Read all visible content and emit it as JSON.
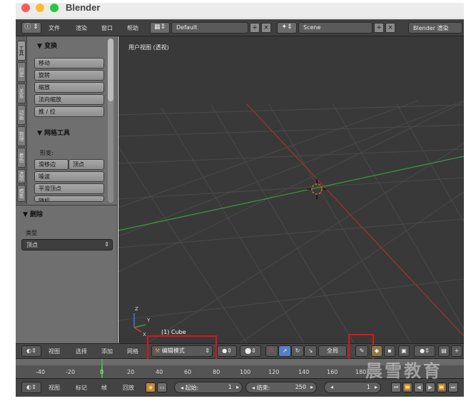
{
  "window": {
    "title": "Blender"
  },
  "info_header": {
    "menus": [
      "文件",
      "渲染",
      "窗口",
      "帮助"
    ],
    "screen_layout": "Default",
    "scene": "Scene",
    "render_engine": "Blender 渲染"
  },
  "tool_shelf": {
    "tabs": [
      "工具",
      "创建",
      "关系",
      "动画",
      "物理",
      "着色",
      "选项",
      "蜡笔"
    ],
    "transform": {
      "title": "▼ 变换",
      "buttons": [
        "移动",
        "旋转",
        "缩放",
        "法向缩放",
        "推 / 拉"
      ]
    },
    "mesh_tools": {
      "title": "▼ 网格工具",
      "deform_label": "形变:",
      "slide_edge": "滑移边",
      "vertex": "顶点",
      "noise": "噪波",
      "smooth_vertex": "平滑顶点",
      "random": "随机"
    },
    "delete": {
      "title": "▼ 删除",
      "type_label": "类型",
      "type_value": "顶点"
    }
  },
  "viewport": {
    "label": "用户视图 (透视)",
    "object": "(1) Cube",
    "axes": {
      "x": "X",
      "y": "Y",
      "z": "Z"
    }
  },
  "view3d_header": {
    "menus": [
      "视图",
      "选择",
      "添加",
      "网格"
    ],
    "mode": "编辑模式",
    "pivot": "全局"
  },
  "timeline": {
    "ticks": [
      "-40",
      "-20",
      "0",
      "20",
      "40",
      "60",
      "80",
      "100",
      "120",
      "140",
      "160",
      "180"
    ],
    "current_frame": 0
  },
  "bottom_header": {
    "menus": [
      "视图",
      "标记",
      "帧",
      "回放"
    ],
    "start_label": "◂ 起始:",
    "start_value": "1",
    "end_label": "◂ 结束:",
    "end_value": "250",
    "current_value": "1"
  },
  "watermark": "晨雪教育",
  "colors": {
    "highlight": "#e0121b",
    "x_axis": "#a03333",
    "y_axis": "#3a9a3a",
    "viewport_bg": "#393939"
  }
}
